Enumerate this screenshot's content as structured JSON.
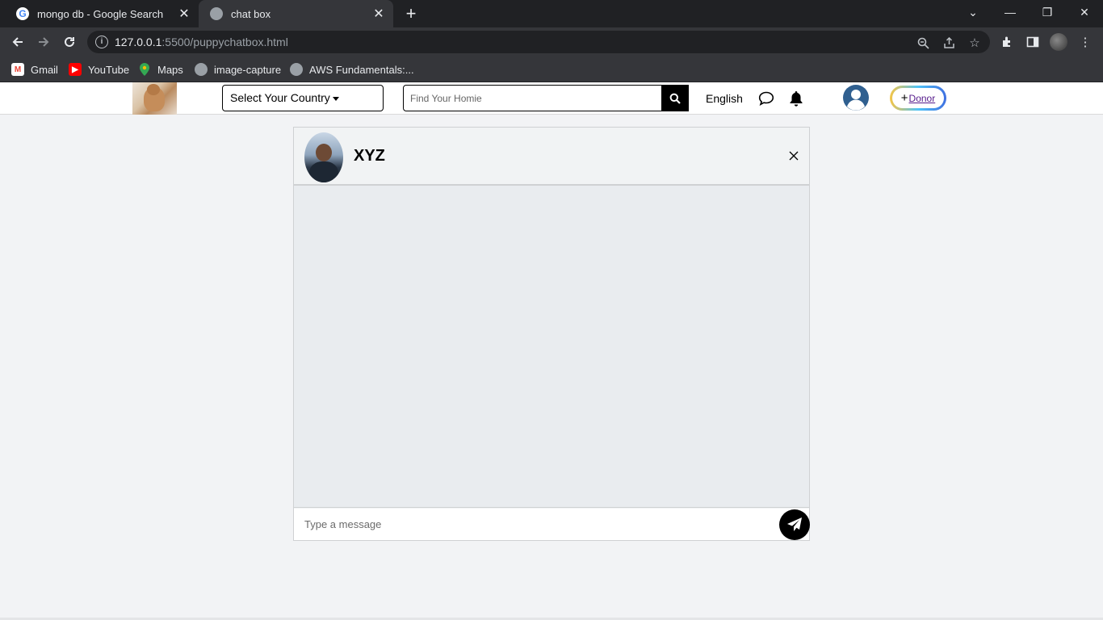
{
  "browser": {
    "tabs": [
      {
        "title": "mongo db - Google Search",
        "icon": "google-icon",
        "active": false
      },
      {
        "title": "chat box",
        "icon": "globe-icon",
        "active": true
      }
    ],
    "new_tab": "+",
    "address": {
      "host": "127.0.0.1",
      "path": ":5500/puppychatbox.html"
    },
    "bookmarks": [
      {
        "label": "Gmail",
        "icon": "gmail-icon",
        "color": "#ea4335"
      },
      {
        "label": "YouTube",
        "icon": "youtube-icon",
        "color": "#ff0000"
      },
      {
        "label": "Maps",
        "icon": "maps-icon",
        "color": "#34a853"
      },
      {
        "label": "image-capture",
        "icon": "globe-icon",
        "color": "#9aa0a6"
      },
      {
        "label": "AWS Fundamentals:...",
        "icon": "globe-icon",
        "color": "#9aa0a6"
      }
    ]
  },
  "header": {
    "country_select": "Select Your Country",
    "search_placeholder": "Find Your Homie",
    "language": "English",
    "donor_plus": "+",
    "donor_label": "Donor"
  },
  "chat": {
    "contact_name": "XYZ",
    "message_placeholder": "Type a message"
  },
  "colors": {
    "chrome_dark": "#202124",
    "chrome_mid": "#35363a",
    "page_bg": "#f2f3f5",
    "accent_black": "#000000",
    "donor_gradient": [
      "#f6c544",
      "#4fc3f7",
      "#3f6fe0"
    ]
  }
}
